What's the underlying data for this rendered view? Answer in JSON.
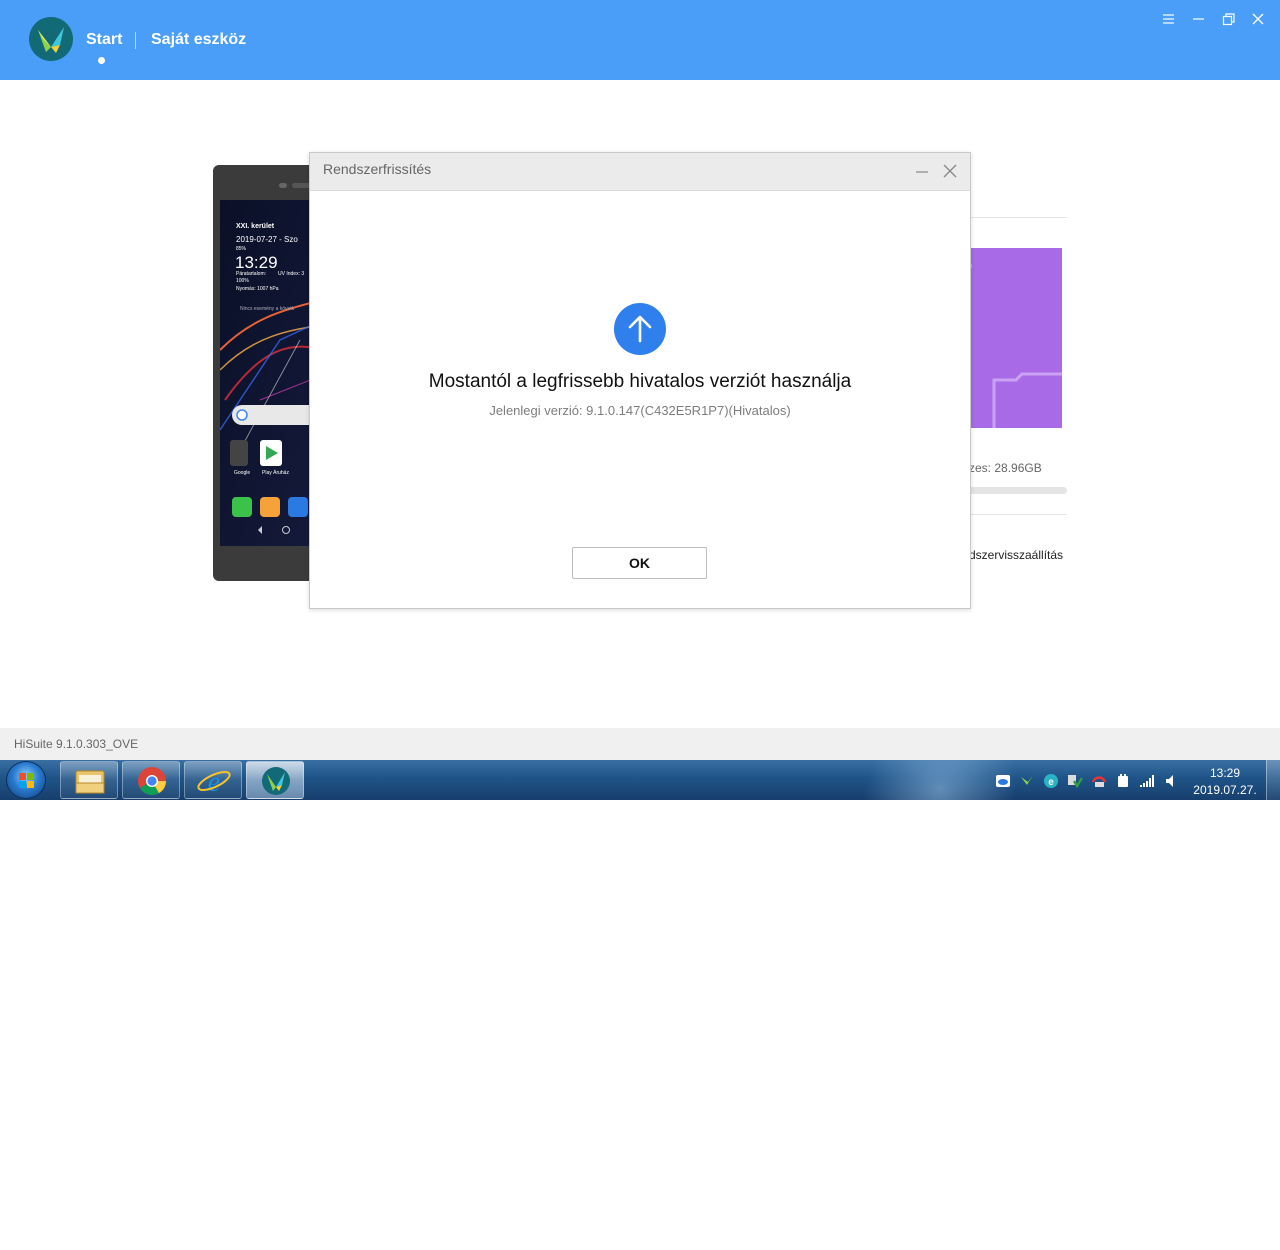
{
  "header": {
    "nav_start": "Start",
    "nav_device": "Saját eszköz"
  },
  "phone_screen": {
    "location": "XXI. kerület",
    "date": "2019-07-27 - Szo",
    "battery": "85%",
    "time": "13:29",
    "humidity_label": "Páratartalom:",
    "humidity": "100%",
    "uv": "UV Index: 3",
    "pressure": "Nyomás: 1007 hPa",
    "no_events": "Nincs esemény a követk",
    "app_google": "Google",
    "app_play": "Play Áruház"
  },
  "device_panel": {
    "storage_text": "zes: 28.96GB",
    "restore_text": "dszervisszaállítás"
  },
  "dialog": {
    "title": "Rendszerfrissítés",
    "heading": "Mostantól a legfrissebb hivatalos verziót használja",
    "version": "Jelenlegi verzió: 9.1.0.147(C432E5R1P7)(Hivatalos)",
    "ok_label": "OK"
  },
  "footer": {
    "version_text": "HiSuite 9.1.0.303_OVE"
  },
  "taskbar": {
    "time": "13:29",
    "date": "2019.07.27."
  },
  "colors": {
    "header_blue": "#4a9ef8",
    "dialog_accent": "#2f80ed",
    "card_purple": "#a86ae6"
  }
}
